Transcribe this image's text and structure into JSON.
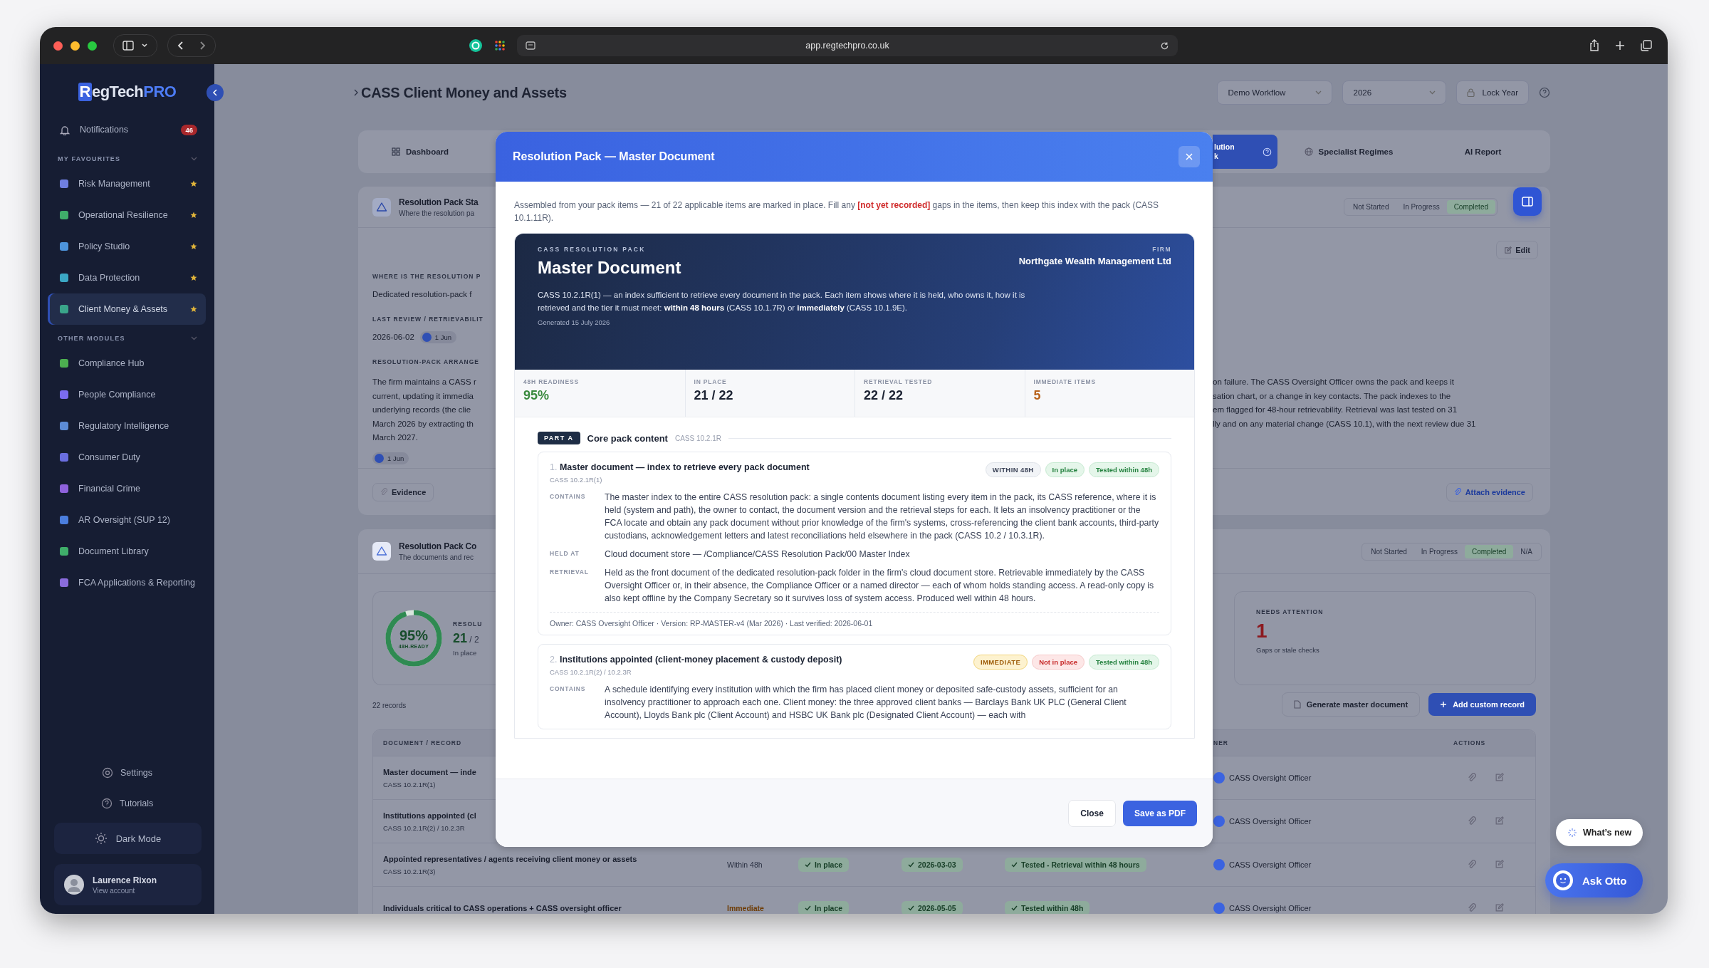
{
  "browser": {
    "url": "app.regtechpro.co.uk"
  },
  "sidebar": {
    "logo": [
      {
        "text": "R",
        "kind": "boxed"
      },
      {
        "text": "egTech",
        "kind": "plain"
      },
      {
        "text": "PRO",
        "kind": "accent"
      }
    ],
    "notifications": {
      "label": "Notifications",
      "badge": "46"
    },
    "sections": [
      {
        "title": "MY FAVOURITES",
        "expanded": true,
        "items": [
          {
            "label": "Risk Management",
            "color": "#6f7fe0",
            "starred": true,
            "selected": false
          },
          {
            "label": "Operational Resilience",
            "color": "#3fae6a",
            "starred": true,
            "selected": false
          },
          {
            "label": "Policy Studio",
            "color": "#4d94dc",
            "starred": true,
            "selected": false
          },
          {
            "label": "Data Protection",
            "color": "#3ba7c4",
            "starred": true,
            "selected": false
          },
          {
            "label": "Client Money & Assets",
            "color": "#3aa58a",
            "starred": true,
            "selected": true
          }
        ]
      },
      {
        "title": "OTHER MODULES",
        "expanded": true,
        "items": [
          {
            "label": "Compliance Hub",
            "color": "#4caf50",
            "starred": false,
            "selected": false
          },
          {
            "label": "People Compliance",
            "color": "#7b6cf0",
            "starred": false,
            "selected": false
          },
          {
            "label": "Regulatory Intelligence",
            "color": "#5c8bd6",
            "starred": false,
            "selected": false
          },
          {
            "label": "Consumer Duty",
            "color": "#6a6ee0",
            "starred": false,
            "selected": false
          },
          {
            "label": "Financial Crime",
            "color": "#8e62dc",
            "starred": false,
            "selected": false
          },
          {
            "label": "AR Oversight (SUP 12)",
            "color": "#4b7ede",
            "starred": false,
            "selected": false
          },
          {
            "label": "Document Library",
            "color": "#3fae6a",
            "starred": false,
            "selected": false
          },
          {
            "label": "FCA Applications & Reporting",
            "color": "#8a6cdc",
            "starred": false,
            "selected": false
          }
        ]
      }
    ],
    "footer_links": [
      {
        "label": "Settings",
        "kind": "settings"
      },
      {
        "label": "Tutorials",
        "kind": "help"
      }
    ],
    "theme_toggle": "Dark Mode",
    "user": {
      "name": "Laurence Rixon",
      "subtitle": "View account"
    }
  },
  "page": {
    "title": "CASS Client Money and Assets",
    "controls": [
      {
        "label": "Demo Workflow",
        "kind": "select"
      },
      {
        "label": "2026",
        "kind": "select"
      },
      {
        "label": "Lock Year",
        "kind": "lock"
      }
    ]
  },
  "tabs": [
    {
      "label": "Dashboard",
      "kind": "grid",
      "selected": false
    },
    {
      "label": "lution\nk",
      "kind": "help",
      "selected": true
    },
    {
      "label": "Specialist Regimes",
      "kind": "globe",
      "selected": false
    },
    {
      "label": "AI Report",
      "kind": "plain",
      "selected": false
    }
  ],
  "arrangement_card": {
    "title": "Resolution Pack Sta",
    "subtitle": "Where the resolution pa",
    "status": [
      {
        "label": "Not Started",
        "selected": false
      },
      {
        "label": "In Progress",
        "selected": false
      },
      {
        "label": "Completed",
        "selected": true
      }
    ],
    "edit": "Edit",
    "fields": [
      {
        "label": "WHERE IS THE RESOLUTION P",
        "value": "Dedicated resolution-pack f"
      },
      {
        "label": "LAST REVIEW / RETRIEVABILIT",
        "value": "2026-06-02",
        "chip": "1 Jun"
      }
    ],
    "arrangement": {
      "label": "RESOLUTION-PACK ARRANGE",
      "lines_left": [
        "The firm maintains a CASS r",
        "current, updating it immedia",
        "underlying records (the clie",
        "March 2026 by extracting th",
        "March 2027."
      ],
      "lines_right": [
        "on failure. The CASS Oversight Officer owns the pack and keeps it",
        "sation chart, or a change in key contacts. The pack indexes to the",
        "em flagged for 48-hour retrievability. Retrieval was last tested on 31",
        "lly and on any material change (CASS 10.1), with the next review due 31"
      ],
      "chip": "1 Jun"
    },
    "evidence": "Evidence",
    "attach": "Attach evidence"
  },
  "pack_card": {
    "title": "Resolution Pack Co",
    "subtitle": "The documents and rec",
    "status": [
      {
        "label": "Not Started",
        "selected": false
      },
      {
        "label": "In Progress",
        "selected": false
      },
      {
        "label": "Completed",
        "selected": true
      },
      {
        "label": "N/A",
        "selected": false
      }
    ],
    "readiness": {
      "level": 0.95,
      "value": "95%",
      "caption": "48H-READY",
      "label": "RESOLU",
      "count": "21",
      "total": "/ 2",
      "note": "In place"
    },
    "attention": {
      "label": "NEEDS ATTENTION",
      "value": "1",
      "note": "Gaps or stale checks"
    },
    "records": "22 records",
    "actions": [
      {
        "label": "Generate master document",
        "kind": "secondary"
      },
      {
        "label": "Add custom record",
        "kind": "primary"
      }
    ],
    "columns": {
      "document": "DOCUMENT / RECORD",
      "owner": "NER",
      "actions": "ACTIONS"
    },
    "rows": [
      {
        "document": "Master document — inde",
        "ref": "CASS 10.2.1R(1)",
        "owner": "CASS Oversight Officer"
      },
      {
        "document": "Institutions appointed (cl",
        "ref": "CASS 10.2.1R(2) / 10.2.3R",
        "owner": "CASS Oversight Officer"
      },
      {
        "document": "Appointed representatives / agents receiving client money or assets",
        "ref": "CASS 10.2.1R(3)",
        "tier": {
          "label": "Within 48h",
          "kind": "standard"
        },
        "in_place": "In place",
        "verified": "2026-03-03",
        "tested": "Tested - Retrieval within 48 hours",
        "owner": "CASS Oversight Officer"
      },
      {
        "document": "Individuals critical to CASS operations + CASS oversight officer",
        "tier": {
          "label": "Immediate",
          "kind": "immediate"
        },
        "in_place": "In place",
        "verified": "2026-05-05",
        "tested": "Tested within 48h",
        "owner": "CASS Oversight Officer"
      }
    ]
  },
  "modal": {
    "title": "Resolution Pack — Master Document",
    "intro": {
      "before": "Assembled from your pack items — 21 of 22 applicable items are marked in place. Fill any",
      "flag": "[not yet recorded]",
      "after": "gaps in the items, then keep this index with the pack (CASS 10.1.11R)."
    },
    "hero": {
      "eyebrow": "CASS RESOLUTION PACK",
      "title": "Master Document",
      "firm_label": "FIRM",
      "firm": "Northgate Wealth Management Ltd",
      "description": "CASS 10.2.1R(1) — an index sufficient to retrieve every document in the pack. Each item shows where it is held, who owns it, how it is retrieved and the tier it must meet: **within 48 hours** (CASS 10.1.7R) or **immediately** (CASS 10.1.9E).",
      "generated": "Generated 15 July 2026"
    },
    "stats": [
      {
        "label": "48H READINESS",
        "value": "95%",
        "kind": "good"
      },
      {
        "label": "IN PLACE",
        "value": "21 / 22",
        "kind": "neutral"
      },
      {
        "label": "RETRIEVAL TESTED",
        "value": "22 / 22",
        "kind": "neutral"
      },
      {
        "label": "IMMEDIATE ITEMS",
        "value": "5",
        "kind": "warn"
      }
    ],
    "section": {
      "badge": "PART A",
      "title": "Core pack content",
      "ref": "CASS 10.2.1R"
    },
    "items": [
      {
        "number": "1.",
        "title": "Master document — index to retrieve every pack document",
        "ref": "CASS 10.2.1R(1)",
        "badges": [
          {
            "label": "WITHIN 48H",
            "kind": "tier"
          },
          {
            "label": "In place",
            "kind": "ok"
          },
          {
            "label": "Tested within 48h",
            "kind": "ok"
          }
        ],
        "fields": [
          {
            "label": "CONTAINS",
            "text": "The master index to the entire CASS resolution pack: a single contents document listing every item in the pack, its CASS reference, where it is held (system and path), the owner to contact, the document version and the retrieval steps for each. It lets an insolvency practitioner or the FCA locate and obtain any pack document without prior knowledge of the firm's systems, cross-referencing the client bank accounts, third-party custodians, acknowledgement letters and latest reconciliations held elsewhere in the pack (CASS 10.2 / 10.3.1R)."
          },
          {
            "label": "HELD AT",
            "text": "Cloud document store — /Compliance/CASS Resolution Pack/00 Master Index"
          },
          {
            "label": "RETRIEVAL",
            "text": "Held as the front document of the dedicated resolution-pack folder in the firm's cloud document store. Retrievable immediately by the CASS Oversight Officer or, in their absence, the Compliance Officer or a named director — each of whom holds standing access. A read-only copy is also kept offline by the Company Secretary so it survives loss of system access. Produced well within 48 hours."
          }
        ],
        "footer": "Owner: CASS Oversight Officer · Version: RP-MASTER-v4 (Mar 2026) · Last verified: 2026-06-01"
      },
      {
        "number": "2.",
        "title": "Institutions appointed (client-money placement & custody deposit)",
        "ref": "CASS 10.2.1R(2) / 10.2.3R",
        "badges": [
          {
            "label": "IMMEDIATE",
            "kind": "immediate"
          },
          {
            "label": "Not in place",
            "kind": "missing"
          },
          {
            "label": "Tested within 48h",
            "kind": "ok"
          }
        ],
        "fields": [
          {
            "label": "CONTAINS",
            "text": "A schedule identifying every institution with which the firm has placed client money or deposited safe-custody assets, sufficient for an insolvency practitioner to approach each one. Client money: the three approved client banks — Barclays Bank UK PLC (General Client Account), Lloyds Bank plc (Client Account) and HSBC UK Bank plc (Designated Client Account) — each with"
          }
        ]
      }
    ],
    "buttons": [
      {
        "label": "Close",
        "kind": "secondary"
      },
      {
        "label": "Save as PDF",
        "kind": "primary"
      }
    ]
  },
  "floating": {
    "whats_new": "What’s new",
    "assistant": "Ask Otto"
  }
}
